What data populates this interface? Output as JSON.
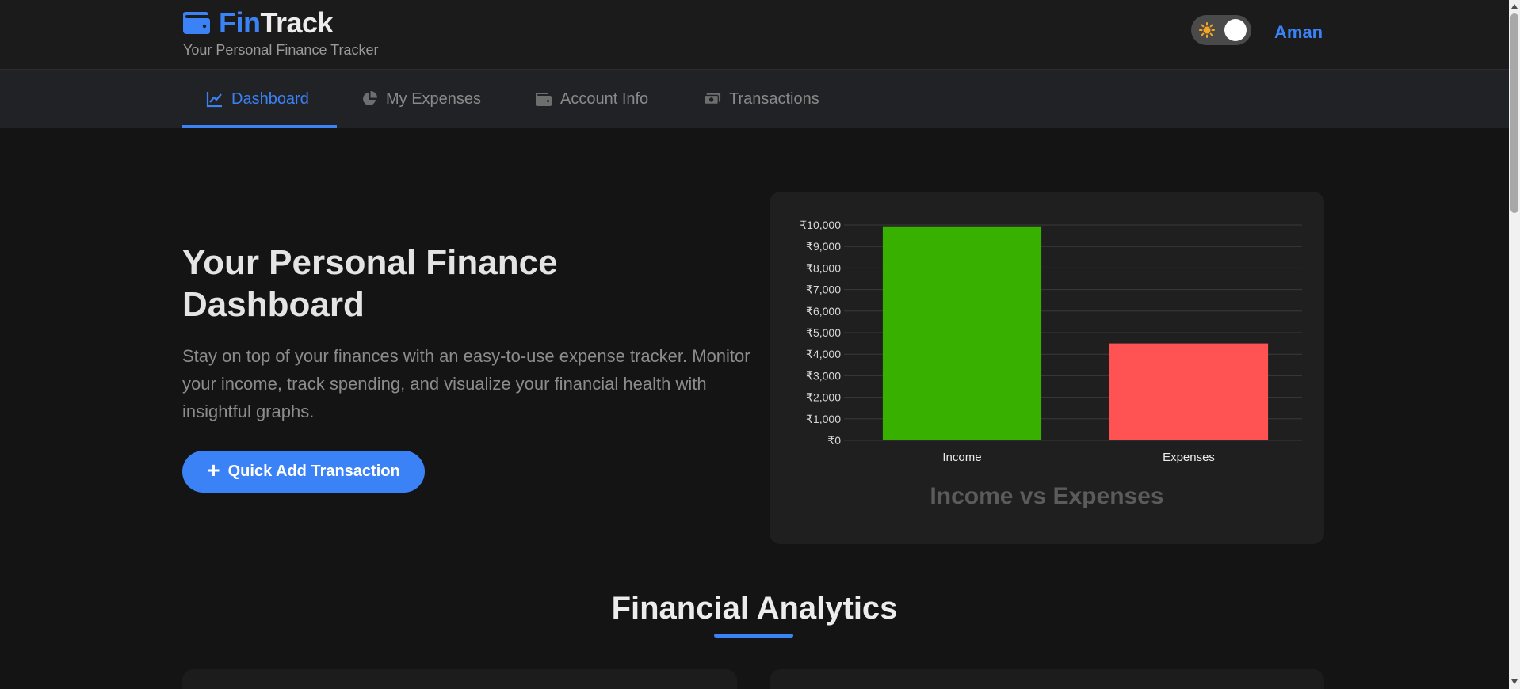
{
  "brand": {
    "name_part1": "Fin",
    "name_part2": "Track",
    "tagline": "Your Personal Finance Tracker",
    "accent": "#3b82f6"
  },
  "header": {
    "theme_toggle_icon": "sun-icon",
    "username": "Aman"
  },
  "nav": {
    "items": [
      {
        "label": "Dashboard",
        "icon": "line-chart-icon",
        "active": true
      },
      {
        "label": "My Expenses",
        "icon": "pie-chart-icon",
        "active": false
      },
      {
        "label": "Account Info",
        "icon": "wallet-icon",
        "active": false
      },
      {
        "label": "Transactions",
        "icon": "money-bill-icon",
        "active": false
      }
    ]
  },
  "hero": {
    "title": "Your Personal Finance Dashboard",
    "description": "Stay on top of your finances with an easy-to-use expense tracker. Monitor your income, track spending, and visualize your financial health with insightful graphs.",
    "cta_label": "Quick Add Transaction"
  },
  "chart_data": {
    "type": "bar",
    "title": "Income vs Expenses",
    "categories": [
      "Income",
      "Expenses"
    ],
    "values": [
      9900,
      4500
    ],
    "colors": [
      "#38b000",
      "#ff5252"
    ],
    "ylim": [
      0,
      10000
    ],
    "yticks": [
      "₹0",
      "₹1,000",
      "₹2,000",
      "₹3,000",
      "₹4,000",
      "₹5,000",
      "₹6,000",
      "₹7,000",
      "₹8,000",
      "₹9,000",
      "₹10,000"
    ],
    "grid": true,
    "legend": "none"
  },
  "analytics": {
    "title": "Financial Analytics"
  }
}
